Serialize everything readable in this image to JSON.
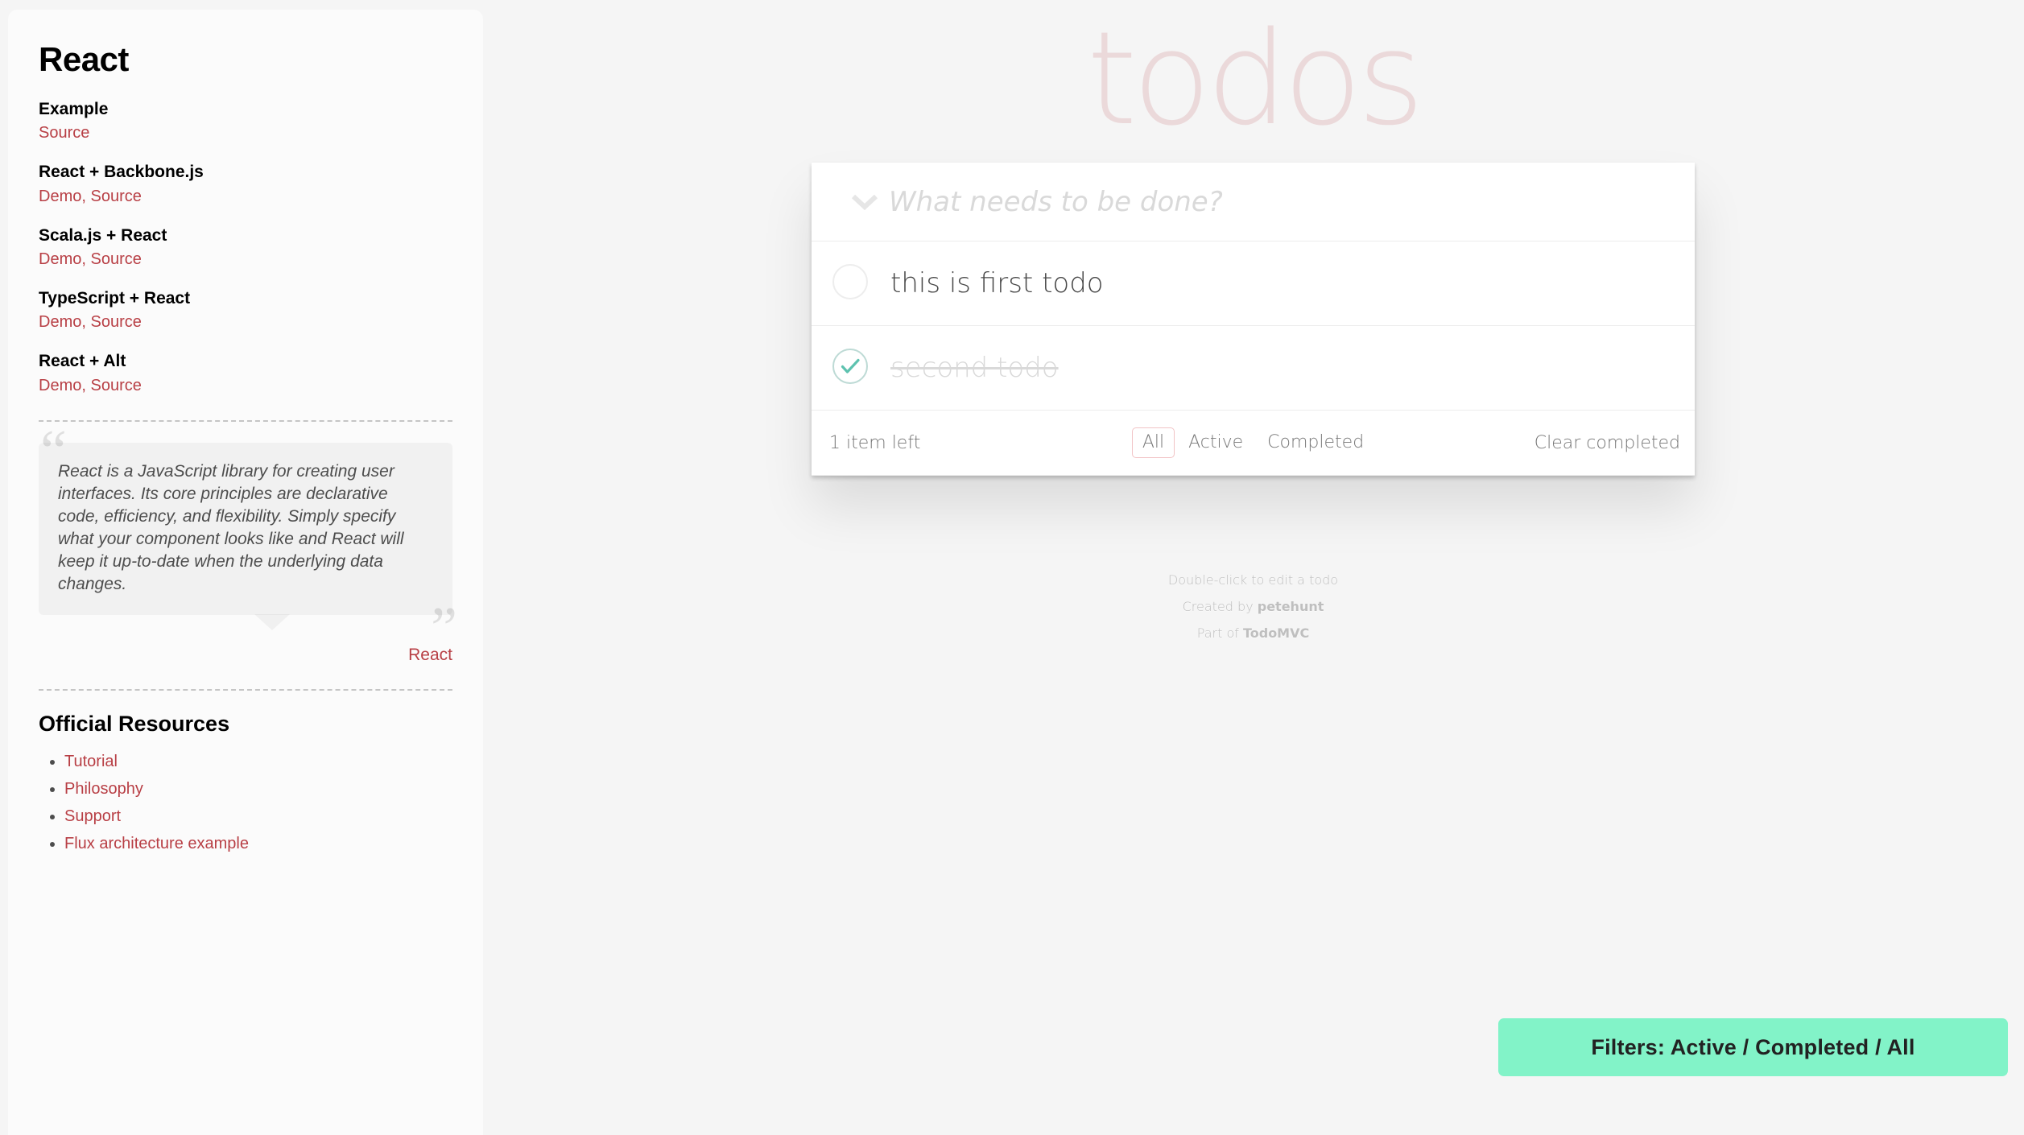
{
  "sidebar": {
    "title": "React",
    "demos": [
      {
        "name": "Example",
        "links": [
          {
            "label": "Source"
          }
        ]
      },
      {
        "name": "React + Backbone.js",
        "links": [
          {
            "label": "Demo"
          },
          {
            "label": "Source"
          }
        ]
      },
      {
        "name": "Scala.js + React",
        "links": [
          {
            "label": "Demo"
          },
          {
            "label": "Source"
          }
        ]
      },
      {
        "name": "TypeScript + React",
        "links": [
          {
            "label": "Demo"
          },
          {
            "label": "Source"
          }
        ]
      },
      {
        "name": "React + Alt",
        "links": [
          {
            "label": "Demo"
          },
          {
            "label": "Source"
          }
        ]
      }
    ],
    "quote": "React is a JavaScript library for creating user interfaces. Its core principles are declarative code, efficiency, and flexibility. Simply specify what your component looks like and React will keep it up-to-date when the underlying data changes.",
    "quote_source": "React",
    "resources_title": "Official Resources",
    "resources": [
      {
        "label": "Tutorial"
      },
      {
        "label": "Philosophy"
      },
      {
        "label": "Support"
      },
      {
        "label": "Flux architecture example"
      }
    ]
  },
  "app": {
    "title": "todos",
    "new_todo_placeholder": "What needs to be done?",
    "new_todo_value": "",
    "todos": [
      {
        "label": "this is first todo",
        "completed": false
      },
      {
        "label": "second todo",
        "completed": true
      }
    ],
    "count_text": "1 item left",
    "filters": [
      {
        "label": "All",
        "selected": true
      },
      {
        "label": "Active",
        "selected": false
      },
      {
        "label": "Completed",
        "selected": false
      }
    ],
    "clear_completed_label": "Clear completed"
  },
  "info": {
    "line1": "Double-click to edit a todo",
    "created_by_prefix": "Created by ",
    "created_by": "petehunt",
    "part_of_prefix": "Part of ",
    "part_of": "TodoMVC"
  },
  "banner": {
    "text": "Filters: Active / Completed / All"
  },
  "icons": {
    "toggle_all": "chevron-down-icon",
    "toggle_unchecked": "circle-icon",
    "toggle_checked": "circle-check-icon"
  },
  "colors": {
    "accent_red": "#b83f45",
    "title_pink": "rgba(184,63,69,0.15)",
    "check_green": "#5dc2af",
    "banner_green": "#82f3c8",
    "page_bg": "#f5f5f5"
  }
}
